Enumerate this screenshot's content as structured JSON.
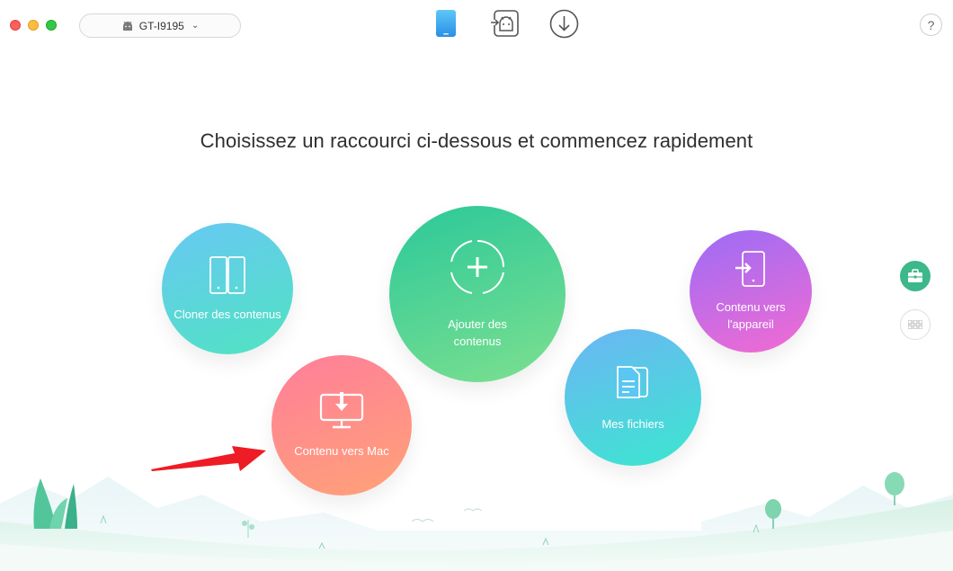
{
  "window": {
    "traffic_lights": [
      "close",
      "minimize",
      "maximize"
    ],
    "device_selector": {
      "label": "GT-I9195",
      "icon": "android-icon"
    }
  },
  "toolbar": {
    "tabs": [
      {
        "name": "device-tab",
        "icon": "phone-icon",
        "active": true
      },
      {
        "name": "android-transfer-tab",
        "icon": "android-transfer-icon"
      },
      {
        "name": "download-tab",
        "icon": "download-icon"
      }
    ],
    "help_label": "?"
  },
  "main": {
    "headline": "Choisissez un raccourci ci-dessous et commencez rapidement",
    "shortcuts": {
      "clone": "Cloner des contenus",
      "add": "Ajouter des contenus",
      "to_device_line1": "Contenu vers",
      "to_device_line2": "l'appareil",
      "files": "Mes fichiers",
      "to_mac": "Contenu vers Mac"
    }
  },
  "side": [
    {
      "name": "toolbox",
      "icon": "toolbox-icon",
      "active": true
    },
    {
      "name": "grid",
      "icon": "grid-icon"
    }
  ],
  "colors": {
    "accent": "#3cb88a",
    "clone": [
      "#68c8f3",
      "#50e3c2"
    ],
    "add": [
      "#2bc89a",
      "#7de08f"
    ],
    "device": [
      "#9b6cf6",
      "#f36bd2"
    ],
    "files": [
      "#6cb5f5",
      "#3be7cf"
    ],
    "mac": [
      "#ff7e9a",
      "#ffa277"
    ],
    "arrow": "#ee1c24"
  }
}
